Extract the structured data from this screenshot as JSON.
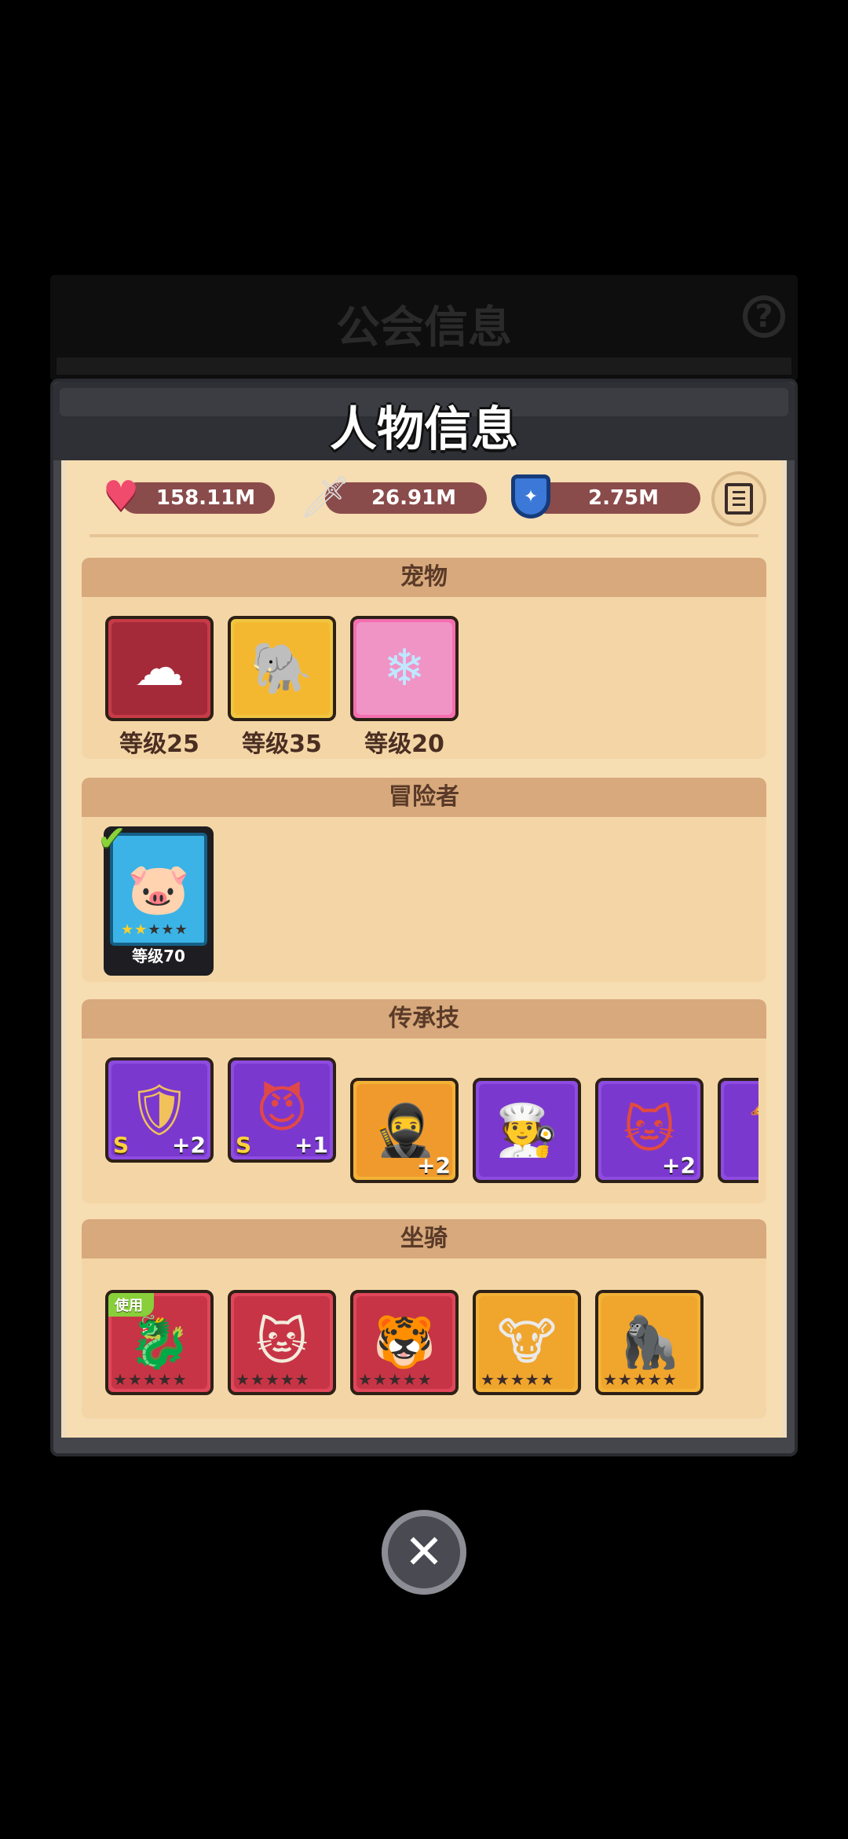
{
  "background_panel": {
    "title": "公会信息",
    "help_icon": "question-icon"
  },
  "modal": {
    "title": "人物信息"
  },
  "stats": {
    "hp": {
      "icon": "heart-icon",
      "value": "158.11M"
    },
    "attack": {
      "icon": "sword-icon",
      "value": "26.91M"
    },
    "defense": {
      "icon": "shield-icon",
      "value": "2.75M"
    },
    "log_icon": "document-icon"
  },
  "sections": {
    "pets": {
      "title": "宠物",
      "items": [
        {
          "name": "pet-1",
          "level_label": "等级25",
          "frame_color": "#c63b46"
        },
        {
          "name": "pet-2",
          "level_label": "等级35",
          "frame_color": "#f0c541"
        },
        {
          "name": "pet-3",
          "level_label": "等级20",
          "frame_color": "#f46fb0"
        }
      ]
    },
    "adventurer": {
      "title": "冒险者",
      "items": [
        {
          "name": "adventurer-1",
          "level_label": "等级70",
          "stars": 2,
          "max_stars": 5,
          "selected": true
        }
      ]
    },
    "inherited_skills": {
      "title": "传承技",
      "items": [
        {
          "rank": "S",
          "plus": "+2",
          "frame": "purple"
        },
        {
          "rank": "S",
          "plus": "+1",
          "frame": "purple"
        },
        {
          "rank": "",
          "plus": "+2",
          "frame": "orange"
        },
        {
          "rank": "",
          "plus": "",
          "frame": "purple"
        },
        {
          "rank": "",
          "plus": "+2",
          "frame": "purple"
        },
        {
          "rank": "",
          "plus": "",
          "frame": "purple"
        }
      ]
    },
    "mounts": {
      "title": "坐骑",
      "in_use_label": "使用",
      "items": [
        {
          "frame": "red",
          "in_use": true
        },
        {
          "frame": "red",
          "in_use": false
        },
        {
          "frame": "red",
          "in_use": false
        },
        {
          "frame": "gold",
          "in_use": false
        },
        {
          "frame": "gold",
          "in_use": false
        }
      ]
    }
  },
  "close_button": {
    "icon": "close-icon"
  }
}
